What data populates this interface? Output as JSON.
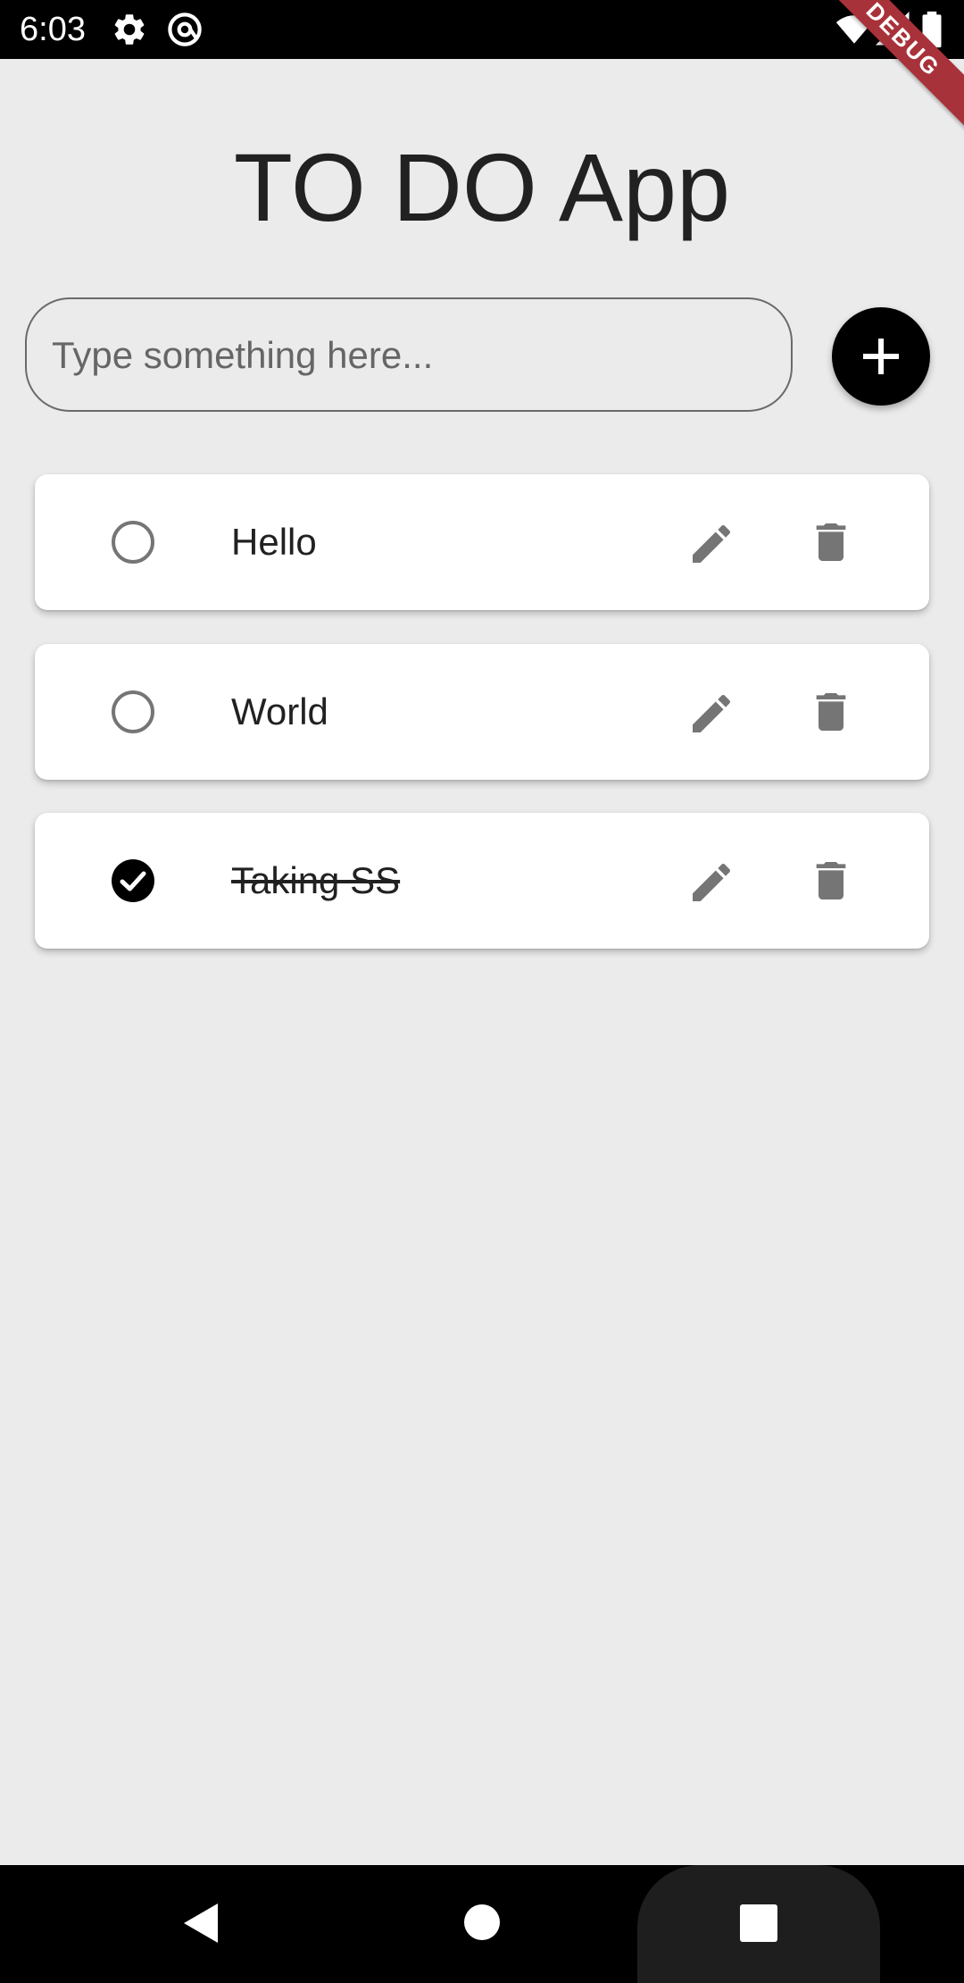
{
  "status_bar": {
    "time": "6:03",
    "left_icons": [
      "gear-icon",
      "at-sign-icon"
    ],
    "right_icons": [
      "wifi-icon",
      "signal-icon",
      "battery-icon"
    ],
    "debug_banner": "DEBUG"
  },
  "app": {
    "title": "TO DO App"
  },
  "input": {
    "placeholder": "Type something here...",
    "value": ""
  },
  "add_button": {
    "icon": "plus-icon"
  },
  "tasks": [
    {
      "label": "Hello",
      "done": false
    },
    {
      "label": "World",
      "done": false
    },
    {
      "label": "Taking SS",
      "done": true
    }
  ],
  "colors": {
    "background": "#ebebeb",
    "card": "#ffffff",
    "accent": "#000000",
    "icon_gray": "#757575",
    "debug_ribbon": "#a8323a"
  },
  "nav_bar": {
    "icons": [
      "back-icon",
      "home-icon",
      "recents-icon"
    ]
  }
}
